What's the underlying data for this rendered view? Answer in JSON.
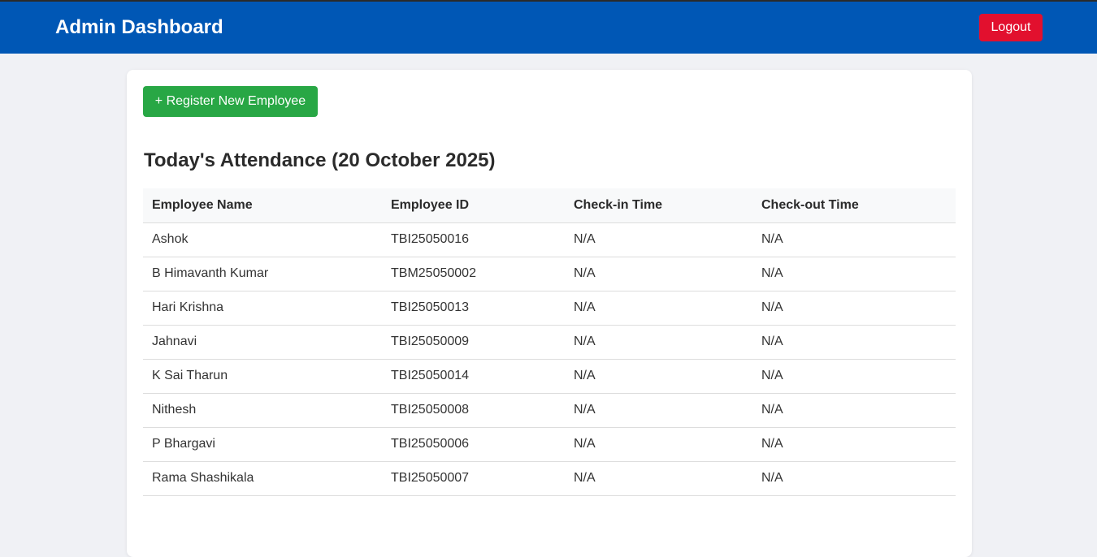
{
  "header": {
    "title": "Admin Dashboard",
    "logout_label": "Logout"
  },
  "main": {
    "register_label": "+ Register New Employee",
    "attendance_title": "Today's Attendance (20 October 2025)",
    "columns": [
      "Employee Name",
      "Employee ID",
      "Check-in Time",
      "Check-out Time"
    ],
    "rows": [
      {
        "name": "Ashok",
        "id": "TBI25050016",
        "check_in": "N/A",
        "check_out": "N/A"
      },
      {
        "name": "B Himavanth Kumar",
        "id": "TBM25050002",
        "check_in": "N/A",
        "check_out": "N/A"
      },
      {
        "name": "Hari Krishna",
        "id": "TBI25050013",
        "check_in": "N/A",
        "check_out": "N/A"
      },
      {
        "name": "Jahnavi",
        "id": "TBI25050009",
        "check_in": "N/A",
        "check_out": "N/A"
      },
      {
        "name": "K Sai Tharun",
        "id": "TBI25050014",
        "check_in": "N/A",
        "check_out": "N/A"
      },
      {
        "name": "Nithesh",
        "id": "TBI25050008",
        "check_in": "N/A",
        "check_out": "N/A"
      },
      {
        "name": "P Bhargavi",
        "id": "TBI25050006",
        "check_in": "N/A",
        "check_out": "N/A"
      },
      {
        "name": "Rama Shashikala",
        "id": "TBI25050007",
        "check_in": "N/A",
        "check_out": "N/A"
      }
    ]
  },
  "colors": {
    "header_bg": "#0057b5",
    "logout_bg": "#e2102e",
    "register_bg": "#28a745",
    "page_bg": "#f0f1f5"
  }
}
